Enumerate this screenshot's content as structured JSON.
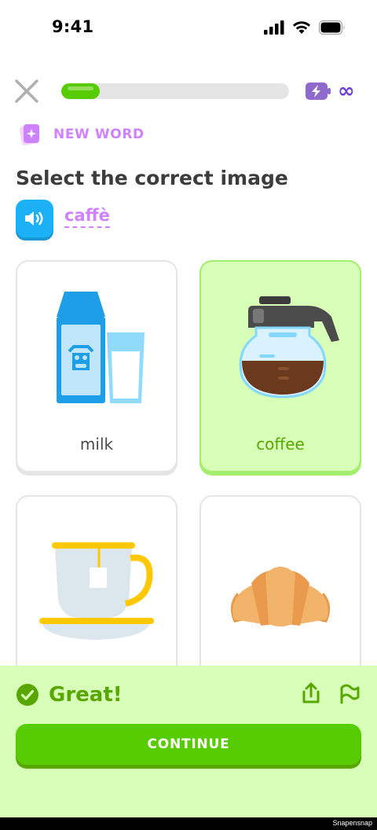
{
  "status_bar": {
    "time": "9:41"
  },
  "progress": {
    "fraction": 0.17
  },
  "energy": {
    "symbol": "∞",
    "color": "#6b3fd4"
  },
  "new_word": {
    "label": "NEW WORD"
  },
  "prompt": {
    "title": "Select the correct image",
    "word": "caffè"
  },
  "options": [
    {
      "label": "milk",
      "selected": false,
      "icon": "milk-carton-glass"
    },
    {
      "label": "coffee",
      "selected": true,
      "icon": "coffee-pot"
    },
    {
      "label": "tea",
      "selected": false,
      "icon": "tea-cup"
    },
    {
      "label": "croissant",
      "selected": false,
      "icon": "croissant"
    }
  ],
  "feedback": {
    "text": "Great!"
  },
  "continue": {
    "label": "CONTINUE"
  },
  "watermark": "Snapensnap",
  "colors": {
    "accent_green": "#58cc02",
    "selected_bg": "#d7ffb8",
    "speaker_blue": "#1cb0f6",
    "new_word_purple": "#ce82ff"
  }
}
